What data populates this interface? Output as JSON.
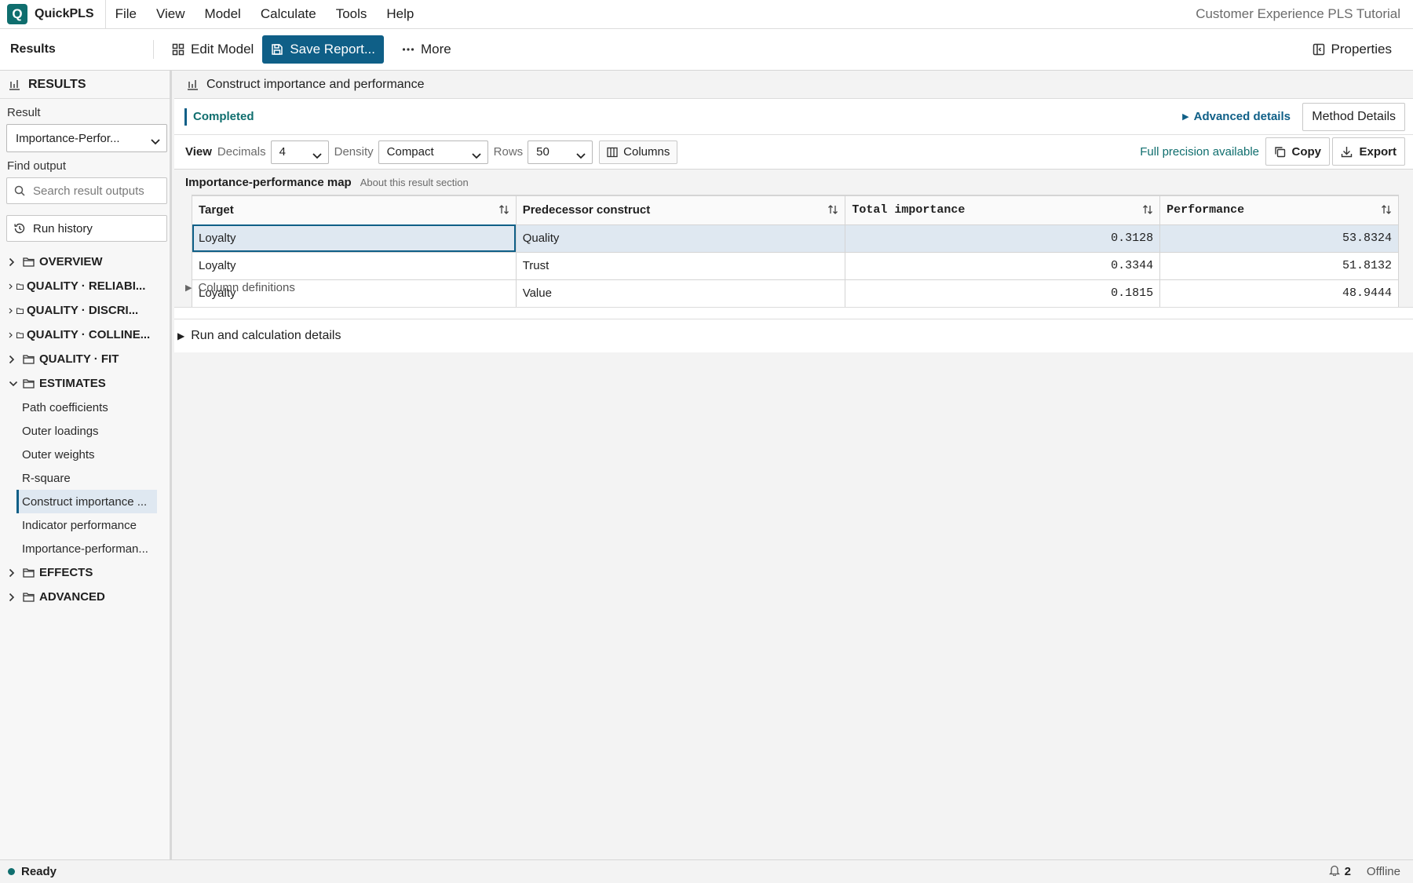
{
  "app": {
    "logo_letter": "Q",
    "name": "QuickPLS",
    "document_title": "Customer Experience PLS Tutorial"
  },
  "menu": [
    "File",
    "View",
    "Model",
    "Calculate",
    "Tools",
    "Help"
  ],
  "toolbar": {
    "section": "Results",
    "edit_model": "Edit Model",
    "save_report": "Save Report...",
    "more": "More",
    "properties": "Properties"
  },
  "sidebar": {
    "title": "RESULTS",
    "result_label": "Result",
    "result_value": "Importance-Perfor...",
    "find_label": "Find output",
    "search_placeholder": "Search result outputs",
    "run_history": "Run history",
    "groups": [
      "OVERVIEW",
      "QUALITY · RELIABI...",
      "QUALITY · DISCRI...",
      "QUALITY · COLLINE...",
      "QUALITY · FIT",
      "ESTIMATES",
      "EFFECTS",
      "ADVANCED"
    ],
    "estimates_items": [
      "Path coefficients",
      "Outer loadings",
      "Outer weights",
      "R-square",
      "Construct importance ...",
      "Indicator performance",
      "Importance-performan..."
    ]
  },
  "main": {
    "title": "Construct importance and performance",
    "status": "Completed",
    "advanced_details": "Advanced details",
    "method_details": "Method Details",
    "view_label": "View",
    "decimals_label": "Decimals",
    "decimals_value": "4",
    "density_label": "Density",
    "density_value": "Compact",
    "rows_label": "Rows",
    "rows_value": "50",
    "columns_button": "Columns",
    "full_precision": "Full precision available",
    "copy": "Copy",
    "export": "Export",
    "section_title": "Importance-performance map",
    "section_about": "About this result section",
    "table": {
      "headers": [
        "Target",
        "Predecessor construct",
        "Total importance",
        "Performance"
      ],
      "rows": [
        [
          "Loyalty",
          "Quality",
          "0.3128",
          "53.8324"
        ],
        [
          "Loyalty",
          "Trust",
          "0.3344",
          "51.8132"
        ],
        [
          "Loyalty",
          "Value",
          "0.1815",
          "48.9444"
        ]
      ]
    },
    "column_definitions": "Column definitions",
    "run_details": "Run and calculation details"
  },
  "statusbar": {
    "ready": "Ready",
    "notifications": "2",
    "connection": "Offline"
  },
  "colors": {
    "accent": "#0f5f87",
    "teal": "#0f6e6e",
    "selected_row": "#dfe8f1"
  }
}
